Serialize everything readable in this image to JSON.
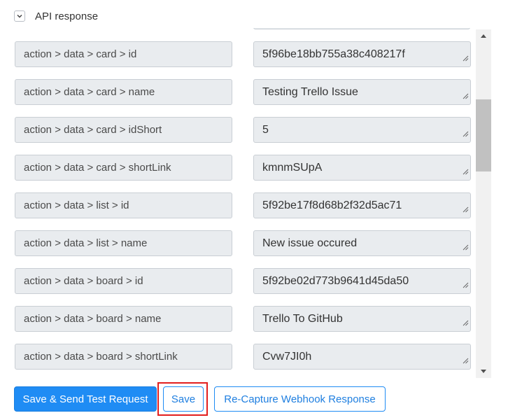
{
  "section": {
    "title": "API response",
    "collapse_icon": "chevron-down-icon"
  },
  "fields": [
    {
      "key": "action > data > card > id",
      "value": "5f96be18bb755a38c408217f"
    },
    {
      "key": "action > data > card > name",
      "value": "Testing Trello Issue"
    },
    {
      "key": "action > data > card > idShort",
      "value": "5"
    },
    {
      "key": "action > data > card > shortLink",
      "value": "kmnmSUpA"
    },
    {
      "key": "action > data > list > id",
      "value": "5f92be17f8d68b2f32d5ac71"
    },
    {
      "key": "action > data > list > name",
      "value": "New issue occured"
    },
    {
      "key": "action > data > board > id",
      "value": "5f92be02d773b9641d45da50"
    },
    {
      "key": "action > data > board > name",
      "value": "Trello To GitHub"
    },
    {
      "key": "action > data > board > shortLink",
      "value": "Cvw7JI0h"
    }
  ],
  "buttons": {
    "save_send": "Save & Send Test Request",
    "save": "Save",
    "recapture": "Re-Capture Webhook Response"
  },
  "colors": {
    "primary": "#1f8cf4",
    "highlight": "#e21e1e",
    "field_bg": "#e9ecef"
  }
}
